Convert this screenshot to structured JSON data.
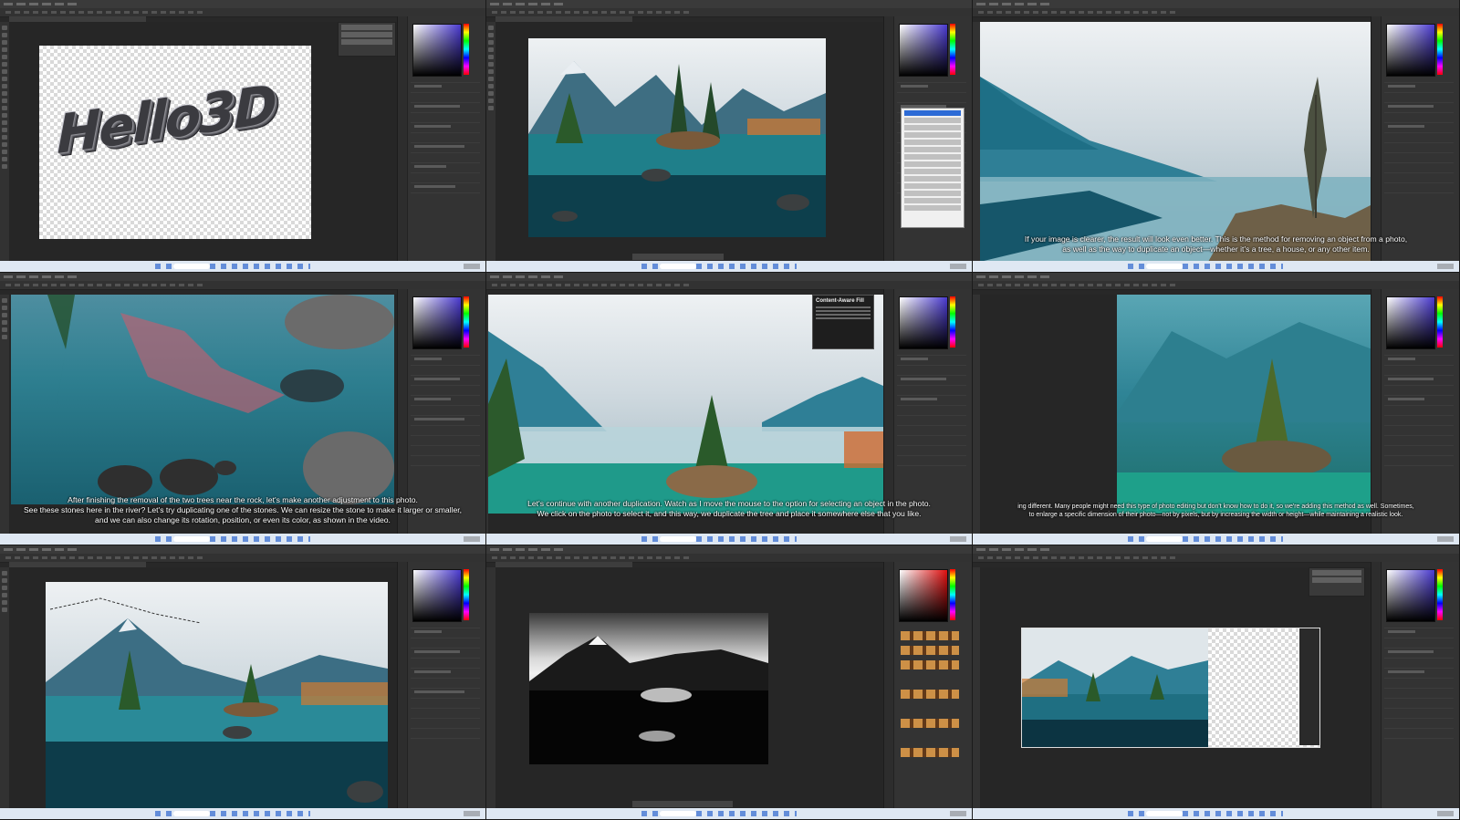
{
  "app": "Adobe Photoshop",
  "panels": [
    {
      "id": "p1",
      "content": "Hello 3D text on transparent canvas",
      "canvas_text": "Hello3D",
      "caption": []
    },
    {
      "id": "p2",
      "content": "Mountain lake photo with islet",
      "caption": []
    },
    {
      "id": "p3",
      "content": "Foggy mountain with single pine",
      "caption": [
        "If your image is clearer, the result will look even better. This is the method for removing an object from a photo,",
        "as well as the way to duplicate an object—whether it's a tree, a house, or any other item."
      ]
    },
    {
      "id": "p4",
      "content": "Lake with rocks and reflection",
      "caption": [
        "After finishing the removal of the two trees near the rock, let's make another adjustment to this photo.",
        "See these stones here in the river? Let's try duplicating one of the stones. We can resize the stone to make it larger or smaller,",
        "and we can also change its rotation, position, or even its color, as shown in the video."
      ]
    },
    {
      "id": "p5",
      "content": "Mountain lake with tree on rocky islet",
      "tooltip_title": "Content-Aware Fill",
      "caption": [
        "Let's continue with another duplication. Watch as I move the mouse to the option for selecting an object in the photo.",
        "We click on the photo to select it, and this way, we duplicate the tree and place it somewhere else that you like."
      ]
    },
    {
      "id": "p6",
      "content": "Tree on islet cropped photo",
      "caption": [
        "ing different. Many people might need this type of photo editing but don't know how to do it, so we're adding this method as well. Sometimes,",
        "to enlarge a specific dimension of their photo—not by pixels, but by increasing the width or height—while maintaining a realistic look."
      ]
    },
    {
      "id": "p7",
      "content": "Full lake panorama with selection",
      "caption": []
    },
    {
      "id": "p8",
      "content": "Black and white landscape",
      "caption": []
    },
    {
      "id": "p9",
      "content": "Extended canvas with transparent area",
      "caption": []
    }
  ],
  "colors": {
    "ps_dark": "#282828",
    "ps_panel": "#333333",
    "taskbar": "#dfe8f3",
    "accent_blue": "#2d6bd6",
    "picker_purple": "#4a3ad0",
    "picker_red": "#e01010"
  }
}
